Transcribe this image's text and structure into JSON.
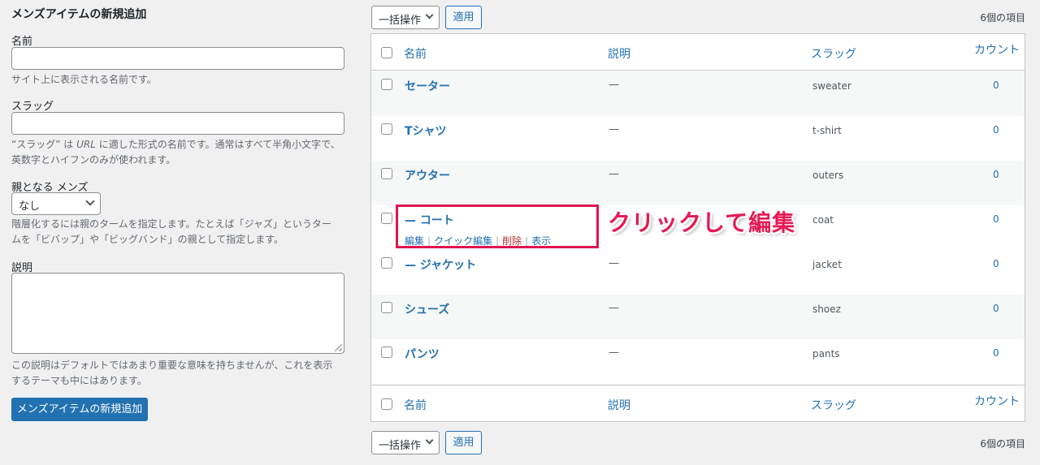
{
  "form": {
    "title": "メンズアイテムの新規追加",
    "name_label": "名前",
    "name_value": "",
    "name_desc": "サイト上に表示される名前です。",
    "slug_label": "スラッグ",
    "slug_value": "",
    "slug_desc_line1_a": "“スラッグ” は ",
    "slug_desc_line1_b": "URL",
    "slug_desc_line1_c": " に適した形式の名前です。通常はすべて半角小文字で、",
    "slug_desc_line2": "英数字とハイフンのみが使われます。",
    "parent_label": "親となる メンズ",
    "parent_selected": "なし",
    "parent_desc_line1": "階層化するには親のタームを指定します。たとえば「ジャズ」というター",
    "parent_desc_line2": "ムを「ビバップ」や「ビッグバンド」の親として指定します。",
    "description_label": "説明",
    "description_value": "",
    "description_desc_line1": "この説明はデフォルトではあまり重要な意味を持ちませんが、これを表示",
    "description_desc_line2": "するテーマも中にはあります。",
    "submit_label": "メンズアイテムの新規追加"
  },
  "toolbar": {
    "bulk_label": "一括操作",
    "apply_label": "適用",
    "item_count": "6個の項目"
  },
  "table": {
    "columns": {
      "name": "名前",
      "description": "説明",
      "slug": "スラッグ",
      "count": "カウント"
    },
    "rows": [
      {
        "name": "セーター",
        "description": "—",
        "slug": "sweater",
        "count": "0"
      },
      {
        "name": "Tシャツ",
        "description": "—",
        "slug": "t-shirt",
        "count": "0"
      },
      {
        "name": "アウター",
        "description": "—",
        "slug": "outers",
        "count": "0"
      },
      {
        "name": "— コート",
        "description": "",
        "slug": "coat",
        "count": "0"
      },
      {
        "name": "— ジャケット",
        "description": "—",
        "slug": "jacket",
        "count": "0"
      },
      {
        "name": "シューズ",
        "description": "—",
        "slug": "shoez",
        "count": "0"
      },
      {
        "name": "パンツ",
        "description": "—",
        "slug": "pants",
        "count": "0"
      }
    ],
    "row_actions": {
      "edit": "編集",
      "quick_edit": "クイック編集",
      "delete": "削除",
      "view": "表示",
      "separator": "|"
    }
  },
  "annotation": {
    "callout_text": "クリックして編集",
    "highlight_color": "#e2144f"
  },
  "colors": {
    "accent": "#2271b1",
    "danger": "#b32d2e",
    "callout": "#e61a55"
  }
}
